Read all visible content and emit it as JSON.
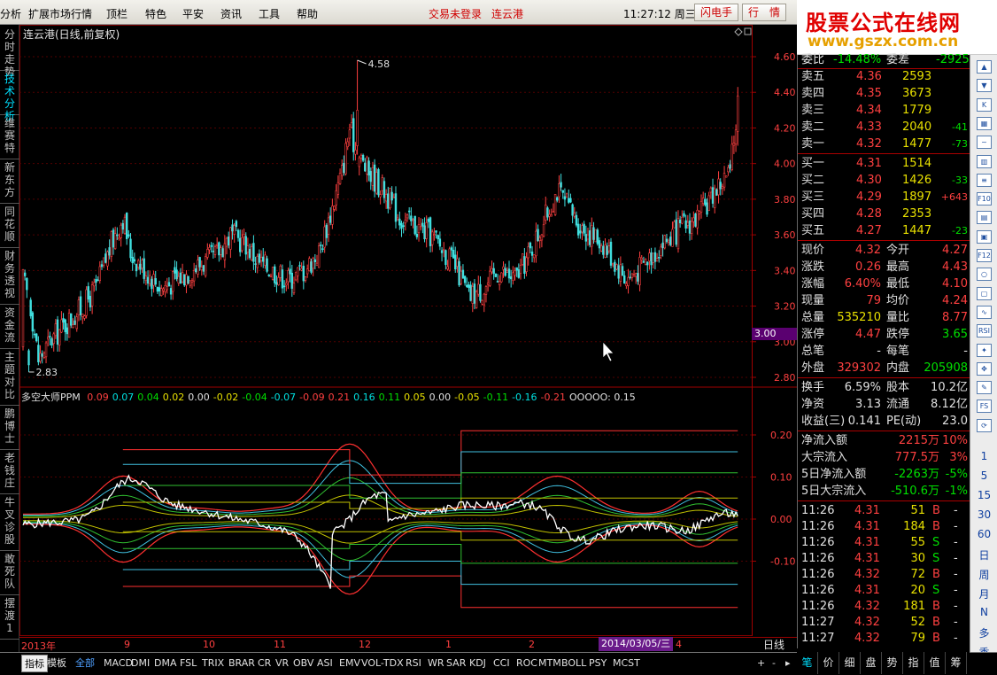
{
  "menubar": {
    "items": [
      "分析",
      "扩展市场行情",
      "顶栏",
      "特色",
      "平安",
      "资讯",
      "工具",
      "帮助"
    ],
    "status": "交易未登录",
    "stock": "连云港",
    "time": "11:27:12 周三",
    "btn_flash": "闪电手",
    "btn_quote": "行　情"
  },
  "watermark": {
    "line1": "股票公式在线网",
    "line2": "www.gszx.com.cn"
  },
  "leftnav": [
    {
      "label": "分时走势",
      "active": false
    },
    {
      "label": "技术分析",
      "active": true
    },
    {
      "label": "维赛特",
      "active": false
    },
    {
      "label": "新东方",
      "active": false
    },
    {
      "label": "同花顺",
      "active": false
    },
    {
      "label": "财务透视",
      "active": false
    },
    {
      "label": "资金流",
      "active": false
    },
    {
      "label": "主题对比",
      "active": false
    },
    {
      "label": "鹏博士",
      "active": false
    },
    {
      "label": "老钱庄",
      "active": false
    },
    {
      "label": "牛叉诊股",
      "active": false
    },
    {
      "label": "敢死队",
      "active": false
    },
    {
      "label": "摆渡1",
      "active": false
    }
  ],
  "chart": {
    "title": "连云港(日线,前复权)",
    "high_label": "4.58",
    "low_label": "2.83",
    "price_ticks": [
      "4.60",
      "4.40",
      "4.20",
      "4.00",
      "3.80",
      "3.60",
      "3.40",
      "3.20",
      "3.00",
      "2.80"
    ],
    "current_tag": "3.00",
    "period": "日线",
    "current_date": "2014/03/05/三",
    "date_ticks": [
      "2013年",
      "9",
      "10",
      "11",
      "12",
      "1",
      "2",
      "4"
    ]
  },
  "indicator": {
    "name": "多空大师PPM",
    "values": [
      {
        "v": "0.09",
        "c": "red"
      },
      {
        "v": "0.07",
        "c": "cyan"
      },
      {
        "v": "0.04",
        "c": "grn"
      },
      {
        "v": "0.02",
        "c": "yel"
      },
      {
        "v": "0.00",
        "c": "w"
      },
      {
        "v": "-0.02",
        "c": "yel"
      },
      {
        "v": "-0.04",
        "c": "grn"
      },
      {
        "v": "-0.07",
        "c": "cyan"
      },
      {
        "v": "-0.09",
        "c": "red"
      },
      {
        "v": "0.21",
        "c": "red"
      },
      {
        "v": "0.16",
        "c": "cyan"
      },
      {
        "v": "0.11",
        "c": "grn"
      },
      {
        "v": "0.05",
        "c": "yel"
      },
      {
        "v": "0.00",
        "c": "w"
      },
      {
        "v": "-0.05",
        "c": "yel"
      },
      {
        "v": "-0.11",
        "c": "grn"
      },
      {
        "v": "-0.16",
        "c": "cyan"
      },
      {
        "v": "-0.21",
        "c": "red"
      }
    ],
    "last_label": "OOOOO: 0.15",
    "axis_ticks": [
      "0.20",
      "0.10",
      "0.00",
      "-0.10"
    ]
  },
  "quote": {
    "weibi": {
      "label": "委比",
      "value": "-14.48%",
      "label2": "委差",
      "value2": "-2925"
    },
    "sells": [
      {
        "label": "卖五",
        "price": "4.36",
        "vol": "2593",
        "chg": ""
      },
      {
        "label": "卖四",
        "price": "4.35",
        "vol": "3673",
        "chg": ""
      },
      {
        "label": "卖三",
        "price": "4.34",
        "vol": "1779",
        "chg": ""
      },
      {
        "label": "卖二",
        "price": "4.33",
        "vol": "2040",
        "chg": "-41"
      },
      {
        "label": "卖一",
        "price": "4.32",
        "vol": "1477",
        "chg": "-73"
      }
    ],
    "buys": [
      {
        "label": "买一",
        "price": "4.31",
        "vol": "1514",
        "chg": ""
      },
      {
        "label": "买二",
        "price": "4.30",
        "vol": "1426",
        "chg": "-33"
      },
      {
        "label": "买三",
        "price": "4.29",
        "vol": "1897",
        "chg": "+643"
      },
      {
        "label": "买四",
        "price": "4.28",
        "vol": "2353",
        "chg": ""
      },
      {
        "label": "买五",
        "price": "4.27",
        "vol": "1447",
        "chg": "-23"
      }
    ],
    "stats": [
      {
        "l1": "现价",
        "v1": "4.32",
        "c1": "red",
        "l2": "今开",
        "v2": "4.27",
        "c2": "red"
      },
      {
        "l1": "涨跌",
        "v1": "0.26",
        "c1": "red",
        "l2": "最高",
        "v2": "4.43",
        "c2": "red"
      },
      {
        "l1": "涨幅",
        "v1": "6.40%",
        "c1": "red",
        "l2": "最低",
        "v2": "4.10",
        "c2": "red"
      },
      {
        "l1": "现量",
        "v1": "79",
        "c1": "red",
        "l2": "均价",
        "v2": "4.24",
        "c2": "red"
      },
      {
        "l1": "总量",
        "v1": "535210",
        "c1": "yel",
        "l2": "量比",
        "v2": "8.77",
        "c2": "red"
      },
      {
        "l1": "涨停",
        "v1": "4.47",
        "c1": "red",
        "l2": "跌停",
        "v2": "3.65",
        "c2": "grn"
      },
      {
        "l1": "总笔",
        "v1": "-",
        "c1": "w",
        "l2": "每笔",
        "v2": "-",
        "c2": "w"
      },
      {
        "l1": "外盘",
        "v1": "329302",
        "c1": "red",
        "l2": "内盘",
        "v2": "205908",
        "c2": "grn"
      }
    ],
    "stats2": [
      {
        "l1": "换手",
        "v1": "6.59%",
        "c1": "w",
        "l2": "股本",
        "v2": "10.2亿",
        "c2": "w"
      },
      {
        "l1": "净资",
        "v1": "3.13",
        "c1": "w",
        "l2": "流通",
        "v2": "8.12亿",
        "c2": "w"
      },
      {
        "l1": "收益(三)",
        "v1": "0.141",
        "c1": "w",
        "l2": "PE(动)",
        "v2": "23.0",
        "c2": "w"
      }
    ],
    "flows": [
      {
        "label": "净流入额",
        "value": "2215万",
        "pct": "10%",
        "c": "red"
      },
      {
        "label": "大宗流入",
        "value": "777.5万",
        "pct": "3%",
        "c": "red"
      },
      {
        "label": "5日净流入额",
        "value": "-2263万",
        "pct": "-5%",
        "c": "grn"
      },
      {
        "label": "5日大宗流入",
        "value": "-510.6万",
        "pct": "-1%",
        "c": "grn"
      }
    ],
    "ticks": [
      {
        "t": "11:26",
        "p": "4.31",
        "v": "51",
        "bs": "B",
        "c": "red"
      },
      {
        "t": "11:26",
        "p": "4.31",
        "v": "184",
        "bs": "B",
        "c": "red"
      },
      {
        "t": "11:26",
        "p": "4.31",
        "v": "55",
        "bs": "S",
        "c": "grn"
      },
      {
        "t": "11:26",
        "p": "4.31",
        "v": "30",
        "bs": "S",
        "c": "grn"
      },
      {
        "t": "11:26",
        "p": "4.32",
        "v": "72",
        "bs": "B",
        "c": "red"
      },
      {
        "t": "11:26",
        "p": "4.31",
        "v": "20",
        "bs": "S",
        "c": "grn"
      },
      {
        "t": "11:26",
        "p": "4.32",
        "v": "181",
        "bs": "B",
        "c": "red"
      },
      {
        "t": "11:27",
        "p": "4.32",
        "v": "52",
        "bs": "B",
        "c": "red"
      },
      {
        "t": "11:27",
        "p": "4.32",
        "v": "79",
        "bs": "B",
        "c": "red"
      }
    ],
    "tick_dash": "-"
  },
  "bottombar": {
    "tabs": [
      "指标",
      "模板",
      "全部",
      "MACD",
      "DMI",
      "DMA",
      "FSL",
      "TRIX",
      "BRAR",
      "CR",
      "VR",
      "OBV",
      "ASI",
      "EMV",
      "VOL-TDX",
      "RSI",
      "WR",
      "SAR",
      "KDJ",
      "CCI",
      "ROC",
      "MTM",
      "BOLL",
      "PSY",
      "MCST"
    ],
    "nav_plus": "+",
    "nav_minus": "-",
    "nav_right": "▸"
  },
  "quote_tabs": [
    "笔",
    "价",
    "细",
    "盘",
    "势",
    "指",
    "值",
    "筹"
  ],
  "right_tools": {
    "icons": [
      "arrow-up",
      "arrow-down",
      "chart",
      "table",
      "line",
      "bars",
      "list",
      "f10",
      "book",
      "doc",
      "f12",
      "circle",
      "zoom",
      "wave",
      "rsi",
      "star",
      "move",
      "pen",
      "fs",
      "refresh"
    ],
    "icon_labels": [
      "▲",
      "▼",
      "K",
      "▦",
      "~",
      "▥",
      "≡",
      "F10",
      "▤",
      "▣",
      "F12",
      "○",
      "▢",
      "∿",
      "RSI",
      "✦",
      "✥",
      "✎",
      "FS",
      "⟳"
    ],
    "periods": [
      "1",
      "5",
      "15",
      "30",
      "60",
      "日",
      "周",
      "月",
      "N",
      "多",
      "季"
    ]
  },
  "colors": {
    "up": "#ff4040",
    "down": "#40e0e0",
    "grid": "#800000",
    "bg": "#000000",
    "accent": "#00e0ff"
  }
}
